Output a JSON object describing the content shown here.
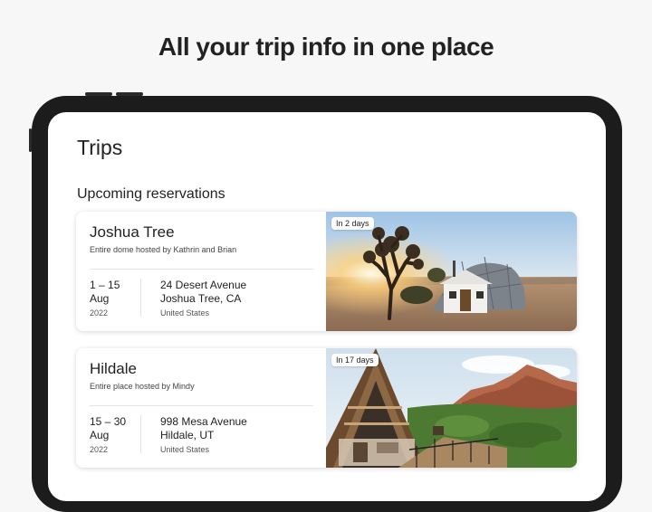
{
  "headline": "All your trip info in one place",
  "page_title": "Trips",
  "section_title": "Upcoming reservations",
  "trips": [
    {
      "name": "Joshua Tree",
      "host": "Entire dome hosted by Kathrin and Brian",
      "days": "1 – 15",
      "month": "Aug",
      "year": "2022",
      "street": "24 Desert Avenue",
      "city": "Joshua Tree, CA",
      "country": "United States",
      "badge": "In 2 days"
    },
    {
      "name": "Hildale",
      "host": "Entire place hosted by Mindy",
      "days": "15 – 30",
      "month": "Aug",
      "year": "2022",
      "street": "998 Mesa Avenue",
      "city": "Hildale, UT",
      "country": "United States",
      "badge": "In 17 days"
    }
  ]
}
